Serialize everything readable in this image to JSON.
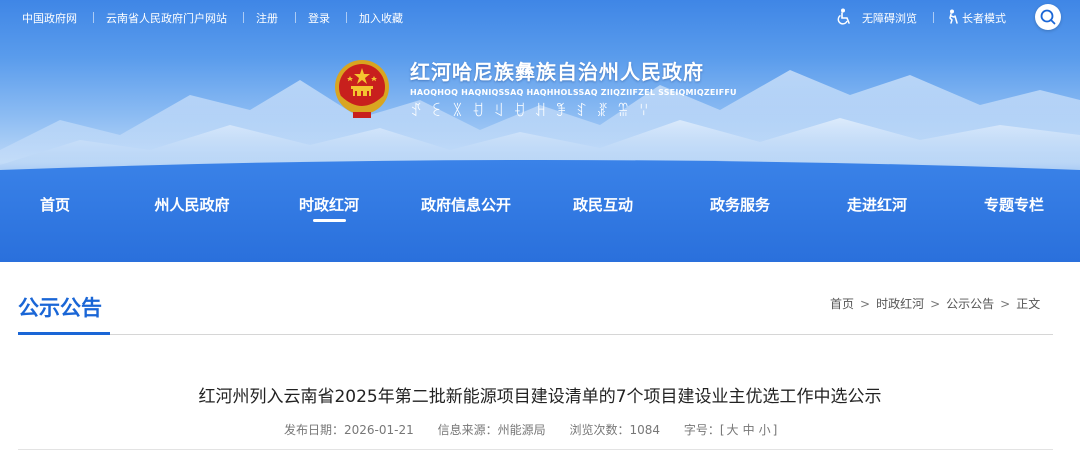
{
  "topbar": {
    "links": [
      "中国政府网",
      "云南省人民政府门户网站",
      "注册",
      "登录",
      "加入收藏"
    ],
    "accessibility_label": "无障碍浏览",
    "elder_label": "长者模式",
    "icons": [
      "wheelchair-icon",
      "elder-icon",
      "search-icon"
    ]
  },
  "header": {
    "title": "红河哈尼族彝族自治州人民政府",
    "subtitle": "HAOQHOQ HAQNIQSSAQ HAQHHOLSSAQ ZIIQZIIFZEL SSEIQMIQZEIFFU",
    "yi_script": "ꀋꏂꇓꀀꆹꀀꃅꊈꆏꁬꍅꈌ"
  },
  "nav": {
    "items": [
      "首页",
      "州人民政府",
      "时政红河",
      "政府信息公开",
      "政民互动",
      "政务服务",
      "走进红河",
      "专题专栏"
    ],
    "active": "时政红河"
  },
  "section": {
    "title": "公示公告"
  },
  "breadcrumb": {
    "items": [
      "首页",
      "时政红河",
      "公示公告",
      "正文"
    ],
    "separator": ">"
  },
  "article": {
    "title": "红河州列入云南省2025年第二批新能源项目建设清单的7个项目建设业主优选工作中选公示",
    "date_label": "发布日期：",
    "date": "2026-01-21",
    "source_label": "信息来源：",
    "source": "州能源局",
    "views_label": "浏览次数：",
    "views": "1084",
    "font_label": "字号：",
    "font_open": "[",
    "font_large": "大",
    "font_medium": "中",
    "font_small": "小",
    "font_close": "]"
  },
  "colors": {
    "brand_blue": "#1a66d6",
    "nav_blue": "#2f78e2"
  }
}
